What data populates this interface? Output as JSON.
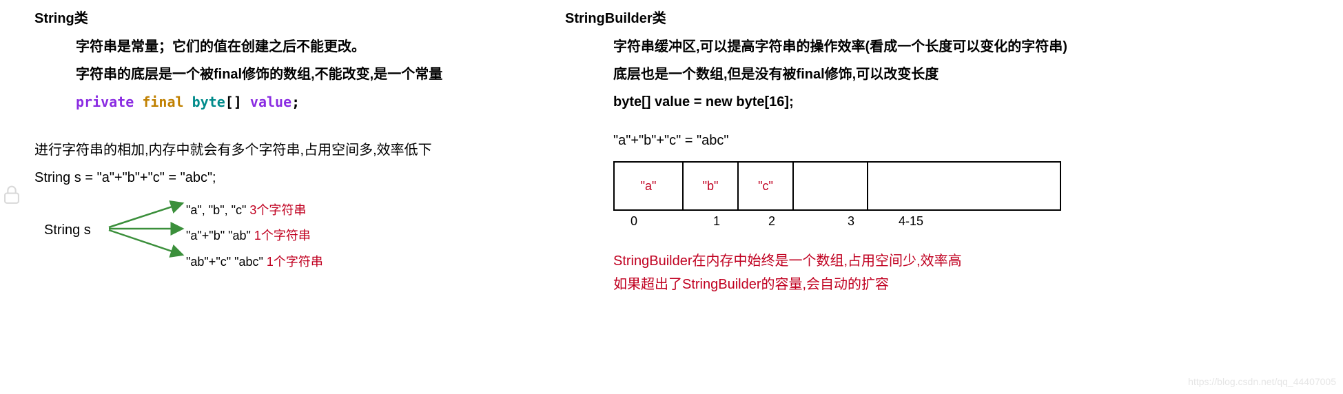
{
  "left": {
    "title": "String类",
    "p1": "字符串是常量；它们的值在创建之后不能更改。",
    "p2": "字符串的底层是一个被final修饰的数组,不能改变,是一个常量",
    "code_private": "private",
    "code_final": "final",
    "code_type": "byte",
    "code_brackets": "[]",
    "code_var": "value",
    "code_semi": ";",
    "p3": "进行字符串的相加,内存中就会有多个字符串,占用空间多,效率低下",
    "p4": "String s = \"a\"+\"b\"+\"c\" = \"abc\";",
    "tree_label": "String s",
    "tree_l1_black": "\"a\", \"b\", \"c\" ",
    "tree_l1_red": "3个字符串",
    "tree_l2_black": "\"a\"+\"b\"  \"ab\" ",
    "tree_l2_red": "1个字符串",
    "tree_l3_black": "\"ab\"+\"c\"  \"abc\" ",
    "tree_l3_red": "1个字符串"
  },
  "right": {
    "title": "StringBuilder类",
    "p1": "字符串缓冲区,可以提高字符串的操作效率(看成一个长度可以变化的字符串)",
    "p2": "底层也是一个数组,但是没有被final修饰,可以改变长度",
    "p3": "byte[] value = new byte[16];",
    "concat": "\"a\"+\"b\"+\"c\" = \"abc\"",
    "cells": [
      "\"a\"",
      "\"b\"",
      "\"c\"",
      "",
      ""
    ],
    "idx0": "0",
    "idx1": "1",
    "idx2": "2",
    "idx3": "3",
    "idx4": "4-15",
    "note1": "StringBuilder在内存中始终是一个数组,占用空间少,效率高",
    "note2": "如果超出了StringBuilder的容量,会自动的扩容"
  },
  "watermark": "https://blog.csdn.net/qq_44407005"
}
